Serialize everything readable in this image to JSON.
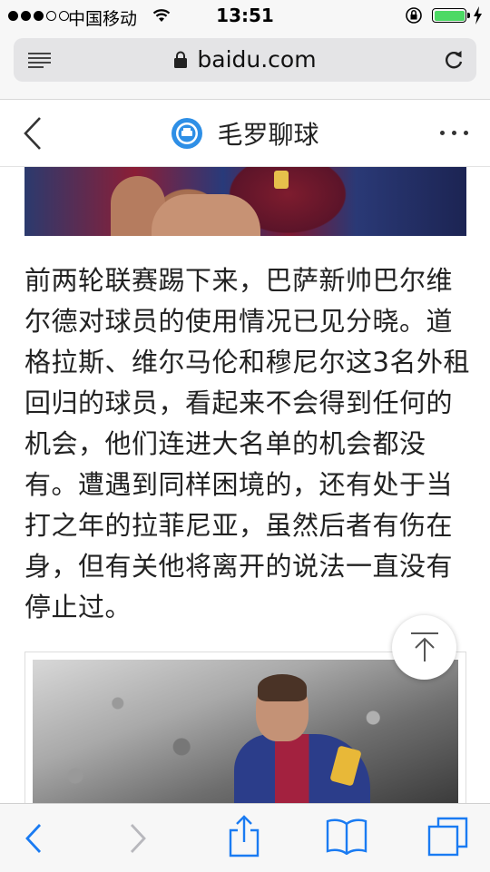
{
  "status_bar": {
    "carrier": "中国移动",
    "time": "13:51",
    "signal_bars_filled": 3,
    "signal_bars_total": 5,
    "battery_color": "#4cd964"
  },
  "browser": {
    "url": "baidu.com",
    "icons": {
      "menu": "menu-lines-icon",
      "lock": "lock-icon",
      "reload": "reload-icon"
    }
  },
  "header": {
    "title": "毛罗聊球",
    "icons": {
      "back": "chevron-left-icon",
      "logo": "brand-logo",
      "more": "more-dots-icon"
    }
  },
  "article": {
    "text": "前两轮联赛踢下来，巴萨新帅巴尔维尔德对球员的使用情况已见分晓。道格拉斯、维尔马伦和穆尼尔这3名外租回归的球员，看起来不会得到任何的机会，他们连进大名单的机会都没有。遭遇到同样困境的，还有处于当打之年的拉菲尼亚，虽然后者有伤在身，但有关他将离开的说法一直没有停止过。"
  },
  "toolbar": {
    "icons": [
      "back-icon",
      "forward-icon",
      "share-icon",
      "bookmarks-icon",
      "tabs-icon"
    ],
    "accent": "#1a7bf2",
    "disabled": "#b8b8bd"
  }
}
